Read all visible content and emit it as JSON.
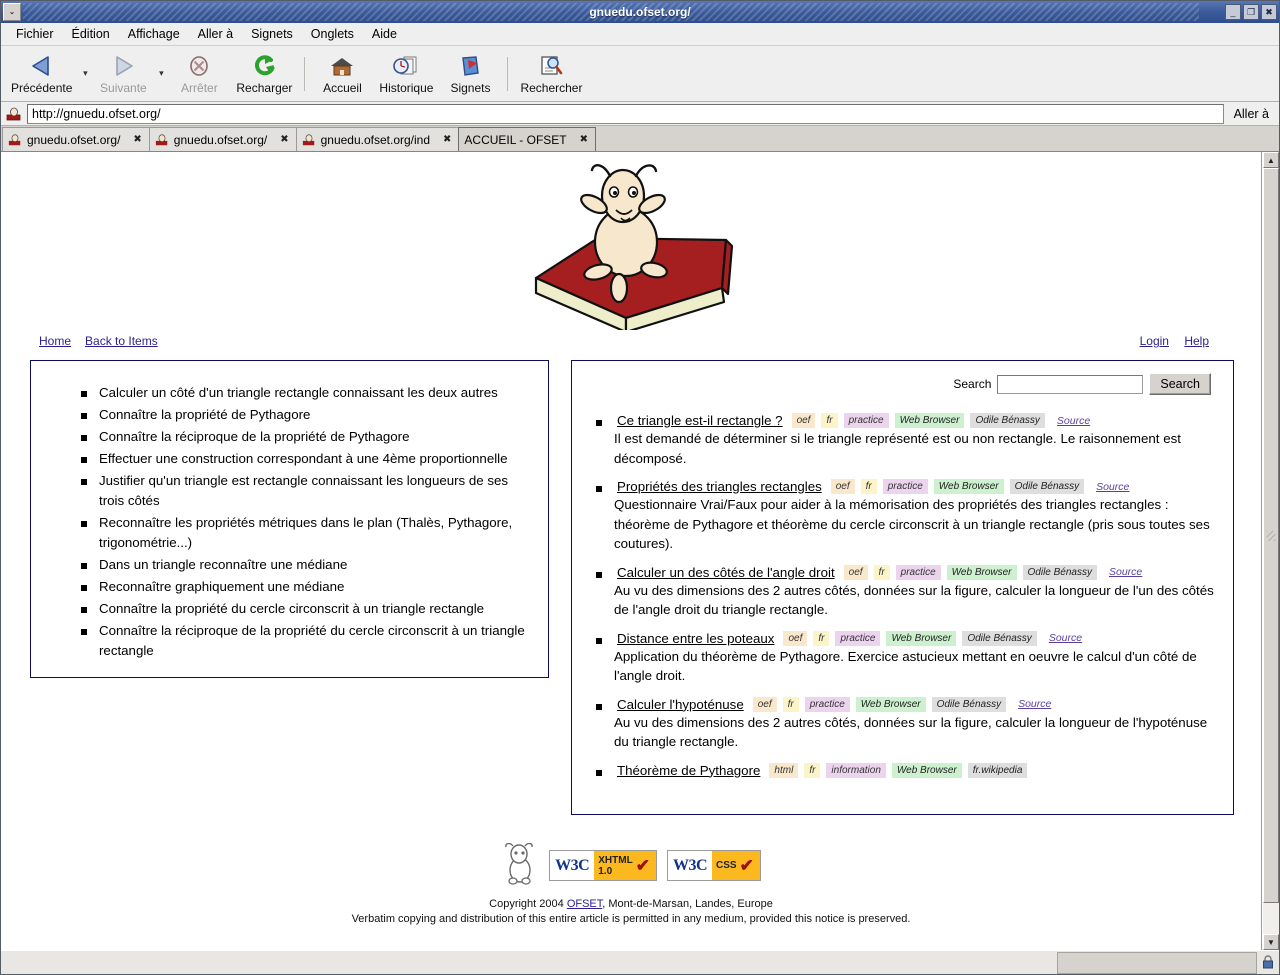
{
  "window": {
    "title": "gnuedu.ofset.org/",
    "controls": {
      "minimize": "_",
      "maximize": "❐",
      "close": "✖"
    },
    "menu_button": "⌄"
  },
  "menubar": [
    {
      "label": "Fichier"
    },
    {
      "label": "Édition"
    },
    {
      "label": "Affichage"
    },
    {
      "label": "Aller à"
    },
    {
      "label": "Signets"
    },
    {
      "label": "Onglets"
    },
    {
      "label": "Aide"
    }
  ],
  "toolbar": {
    "back": "Précédente",
    "forward": "Suivante",
    "stop": "Arrêter",
    "reload": "Recharger",
    "home": "Accueil",
    "history": "Historique",
    "bookmarks": "Signets",
    "search": "Rechercher"
  },
  "urlbar": {
    "value": "http://gnuedu.ofset.org/",
    "go_label": "Aller à"
  },
  "tabs": [
    {
      "label": "gnuedu.ofset.org/",
      "close": "✖",
      "active": false
    },
    {
      "label": "gnuedu.ofset.org/",
      "close": "✖",
      "active": false
    },
    {
      "label": "gnuedu.ofset.org/ind",
      "close": "✖",
      "active": false
    },
    {
      "label": "ACCUEIL - OFSET",
      "close": "✖",
      "active": true
    }
  ],
  "page": {
    "nav": {
      "home": "Home",
      "back_to_items": "Back to Items",
      "login": "Login",
      "help": "Help"
    },
    "goals": [
      "Calculer un côté d'un triangle rectangle connaissant les deux autres",
      "Connaître la propriété de Pythagore",
      "Connaître la réciproque de la propriété de Pythagore",
      "Effectuer une construction correspondant à une 4ème proportionnelle",
      "Justifier qu'un triangle est rectangle connaissant les longueurs de ses trois côtés",
      "Reconnaître les propriétés métriques dans le plan (Thalès, Pythagore, trigonométrie...)",
      "Dans un triangle reconnaître une médiane",
      "Reconnaître graphiquement une médiane",
      "Connaître la propriété du cercle circonscrit à un triangle rectangle",
      "Connaître la réciproque de la propriété du cercle circonscrit à un triangle rectangle"
    ],
    "search": {
      "label": "Search",
      "value": "",
      "placeholder": "",
      "button": "Search"
    },
    "results": [
      {
        "title": "Ce triangle est-il rectangle ?",
        "format": "oef",
        "lang": "fr",
        "kind": "practice",
        "tool": "Web Browser",
        "author": "Odile Bénassy",
        "source": "Source",
        "description": "Il est demandé de déterminer si le triangle représenté est ou non rectangle. Le raisonnement est décomposé."
      },
      {
        "title": "Propriétés des triangles rectangles",
        "format": "oef",
        "lang": "fr",
        "kind": "practice",
        "tool": "Web Browser",
        "author": "Odile Bénassy",
        "source": "Source",
        "description": "Questionnaire Vrai/Faux pour aider à la mémorisation des propriétés des triangles rectangles : théorème de Pythagore et théorème du cercle circonscrit à un triangle rectangle (pris sous toutes ses coutures)."
      },
      {
        "title": "Calculer un des côtés de l'angle droit",
        "format": "oef",
        "lang": "fr",
        "kind": "practice",
        "tool": "Web Browser",
        "author": "Odile Bénassy",
        "source": "Source",
        "description": "Au vu des dimensions des 2 autres côtés, données sur la figure, calculer la longueur de l'un des côtés de l'angle droit du triangle rectangle."
      },
      {
        "title": "Distance entre les poteaux",
        "format": "oef",
        "lang": "fr",
        "kind": "practice",
        "tool": "Web Browser",
        "author": "Odile Bénassy",
        "source": "Source",
        "description": "Application du théorème de Pythagore. Exercice astucieux mettant en oeuvre le calcul d'un côté de l'angle droit."
      },
      {
        "title": "Calculer l'hypoténuse",
        "format": "oef",
        "lang": "fr",
        "kind": "practice",
        "tool": "Web Browser",
        "author": "Odile Bénassy",
        "source": "Source",
        "description": "Au vu des dimensions des 2 autres côtés, données sur la figure, calculer la longueur de l'hypoténuse du triangle rectangle."
      },
      {
        "title": "Théorème de Pythagore",
        "format": "html",
        "lang": "fr",
        "kind": "information",
        "tool": "Web Browser",
        "author": "fr.wikipedia",
        "source": "",
        "description": ""
      }
    ],
    "footer": {
      "xhtml_badge": {
        "w3c": "W3C",
        "line1": "XHTML",
        "line2": "1.0"
      },
      "css_badge": {
        "w3c": "W3C",
        "line1": "CSS"
      },
      "copyright_pre": "Copyright 2004 ",
      "copyright_link": "OFSET",
      "copyright_post": ", Mont-de-Marsan, Landes, Europe",
      "license": "Verbatim copying and distribution of this entire article is permitted in any medium, provided this notice is preserved."
    }
  },
  "statusbar": {
    "text": ""
  }
}
